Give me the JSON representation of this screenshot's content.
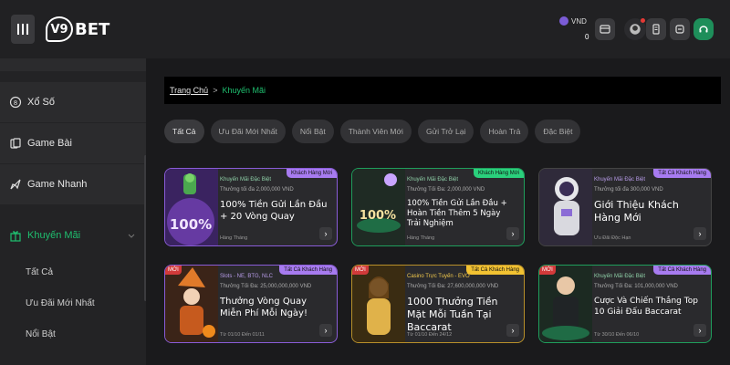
{
  "header": {
    "logo_text": "BET",
    "logo_mark": "V9",
    "currency": "VND",
    "balance": "0",
    "icons": [
      "menu-icon",
      "wallet-icon",
      "user-avatar-icon",
      "document-icon",
      "refresh-icon",
      "headset-icon"
    ]
  },
  "sidebar": {
    "items": [
      {
        "label": "Xổ Số",
        "icon": "lottery-icon"
      },
      {
        "label": "Game Bài",
        "icon": "cards-icon"
      },
      {
        "label": "Game Nhanh",
        "icon": "rocket-icon"
      },
      {
        "label": "Khuyến Mãi",
        "icon": "gift-icon"
      }
    ],
    "sub_items": [
      "Tất Cả",
      "Ưu Đãi Mới Nhất",
      "Nổi Bật"
    ]
  },
  "breadcrumb": {
    "home": "Trang Chủ",
    "separator": ">",
    "current": "Khuyến Mãi"
  },
  "tabs": [
    "Tất Cả",
    "Ưu Đãi Mới Nhất",
    "Nổi Bật",
    "Thành Viên Mới",
    "Gửi Trở Lại",
    "Hoàn Trả",
    "Đặc Biệt"
  ],
  "cards": [
    {
      "badge": "Khách Hàng Mới",
      "category": "Khuyến Mãi Đặc Biệt",
      "max": "Thưởng tối đa 2,000,000 VND",
      "title": "100% Tiền Gửi Lần Đầu + 20 Vòng Quay",
      "date": "Hàng Tháng",
      "art_text": "100%"
    },
    {
      "badge": "Khách Hàng Mới",
      "category": "Khuyến Mãi Đặc Biệt",
      "max": "Thưởng Tối Đa: 2,000,000 VND",
      "title": "100% Tiền Gửi Lần Đầu + Hoàn Tiền Thêm 5 Ngày Trải Nghiệm",
      "date": "Hàng Tháng",
      "art_text": "100%"
    },
    {
      "badge": "Tất Cả Khách Hàng",
      "category": "Khuyến Mãi Đặc Biệt",
      "max": "Thưởng tối đa 300,000 VND",
      "title": "Giới Thiệu Khách Hàng Mới",
      "date": "Ưu Đãi Độc Hạn"
    },
    {
      "badge": "Tất Cả Khách Hàng",
      "new": "MỚI",
      "category": "Slots - NE, BTG, NLC",
      "max": "Thưởng Tối Đa: 25,000,000,000 VND",
      "title": "Thưởng Vòng Quay Miễn Phí Mỗi Ngày!",
      "date": "Từ 01/10 Đến 01/11"
    },
    {
      "badge": "Tất Cả Khách Hàng",
      "new": "MỚI",
      "category": "Casino Trực Tuyến - EVO",
      "max": "Thưởng Tối Đa: 27,600,000,000 VND",
      "title": "1000 Thưởng Tiền Mặt Mỗi Tuần Tại Baccarat",
      "date": "Từ 01/10 Đến 24/12"
    },
    {
      "badge": "Tất Cả Khách Hàng",
      "new": "MỚI",
      "category": "Khuyến Mãi Đặc Biệt",
      "max": "Thưởng Tối Đa: 101,000,000 VND",
      "title": "Cược Và Chiến Thắng Top 10 Giải Đấu Baccarat",
      "date": "Từ 30/10 Đến 06/10"
    }
  ],
  "colors": {
    "accent": "#1fbf6f",
    "purple": "#8a5cd8",
    "bg": "#1a1a1c"
  }
}
